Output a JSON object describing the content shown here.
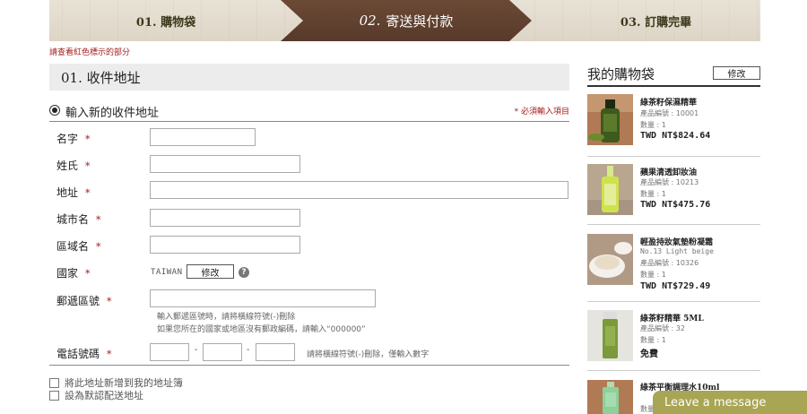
{
  "steps": [
    {
      "label": "01. 購物袋"
    },
    {
      "num": "02.",
      "label": "寄送與付款"
    },
    {
      "label": "03. 訂購完畢"
    }
  ],
  "notice": "請查看紅色標示的部分",
  "section_title": "01. 收件地址",
  "address_option": "輸入新的收件地址",
  "required_note": "* 必須輸入項目",
  "required_marker": "*",
  "fields": {
    "first_name": "名字",
    "last_name": "姓氏",
    "address": "地址",
    "city": "城市名",
    "region": "區域名",
    "country": "國家",
    "postcode": "郵遞區號",
    "phone": "電話號碼"
  },
  "country_value": "TAIWAN",
  "edit_label": "修改",
  "help_glyph": "?",
  "postcode_hint_1": "輸入郵遞區號時，請將橫線符號(-)刪除",
  "postcode_hint_2": "如果您所在的國家或地區沒有郵政編碼，請輸入“000000”",
  "phone_dash": "-",
  "phone_hint": "請將橫線符號(-)刪除，僅輸入數字",
  "checkboxes": [
    "將此地址新增到我的地址簿",
    "設為默認配送地址"
  ],
  "cart": {
    "title": "我的購物袋",
    "edit_label": "修改",
    "items": [
      {
        "name": "綠茶籽保濕精華",
        "code": "產品編號 : 10001",
        "qty": "數量 : 1",
        "price": "TWD NT$824.64"
      },
      {
        "name": "蘋果清透卸妝油",
        "code": "產品編號 : 10213",
        "qty": "數量 : 1",
        "price": "TWD NT$475.76"
      },
      {
        "name": "輕盈持妝氣墊粉凝霜",
        "variant": "No.13 Light beige",
        "code": "產品編號 : 10326",
        "qty": "數量 : 1",
        "price": "TWD NT$729.49"
      },
      {
        "name": "綠茶籽精華 5ML",
        "code": "產品編號 : 32",
        "qty": "數量 : 1",
        "price": "免費"
      },
      {
        "name": "綠茶平衡調理水10ml",
        "qty": "數量"
      }
    ]
  },
  "chat_label": "Leave a message"
}
